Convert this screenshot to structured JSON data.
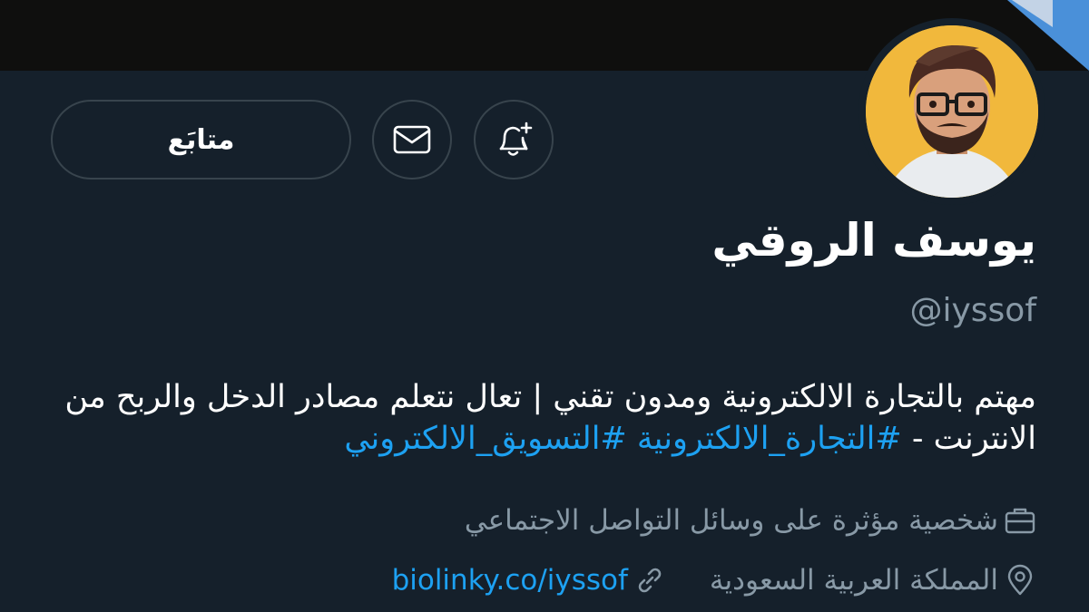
{
  "profile": {
    "display_name": "يوسف الروقي",
    "handle": "@iyssof",
    "bio_text": "مهتم بالتجارة الالكترونية ومدون تقني | تعال نتعلم مصادر الدخل والربح من الانترنت - ",
    "hashtags": [
      "#التجارة_الالكترونية",
      "#التسويق_الالكتروني"
    ],
    "category": "شخصية مؤثرة على وسائل التواصل الاجتماعي",
    "location": "المملكة العربية السعودية",
    "website": "biolinky.co/iyssof"
  },
  "actions": {
    "follow_label": "متابَع"
  },
  "icons": {
    "mail": "mail-icon",
    "notify": "bell-plus-icon",
    "category": "briefcase-icon",
    "location": "location-pin-icon",
    "link": "link-icon"
  },
  "colors": {
    "background": "#15202b",
    "accent": "#1da1f2",
    "muted": "#8899a6",
    "border": "#38444d"
  }
}
